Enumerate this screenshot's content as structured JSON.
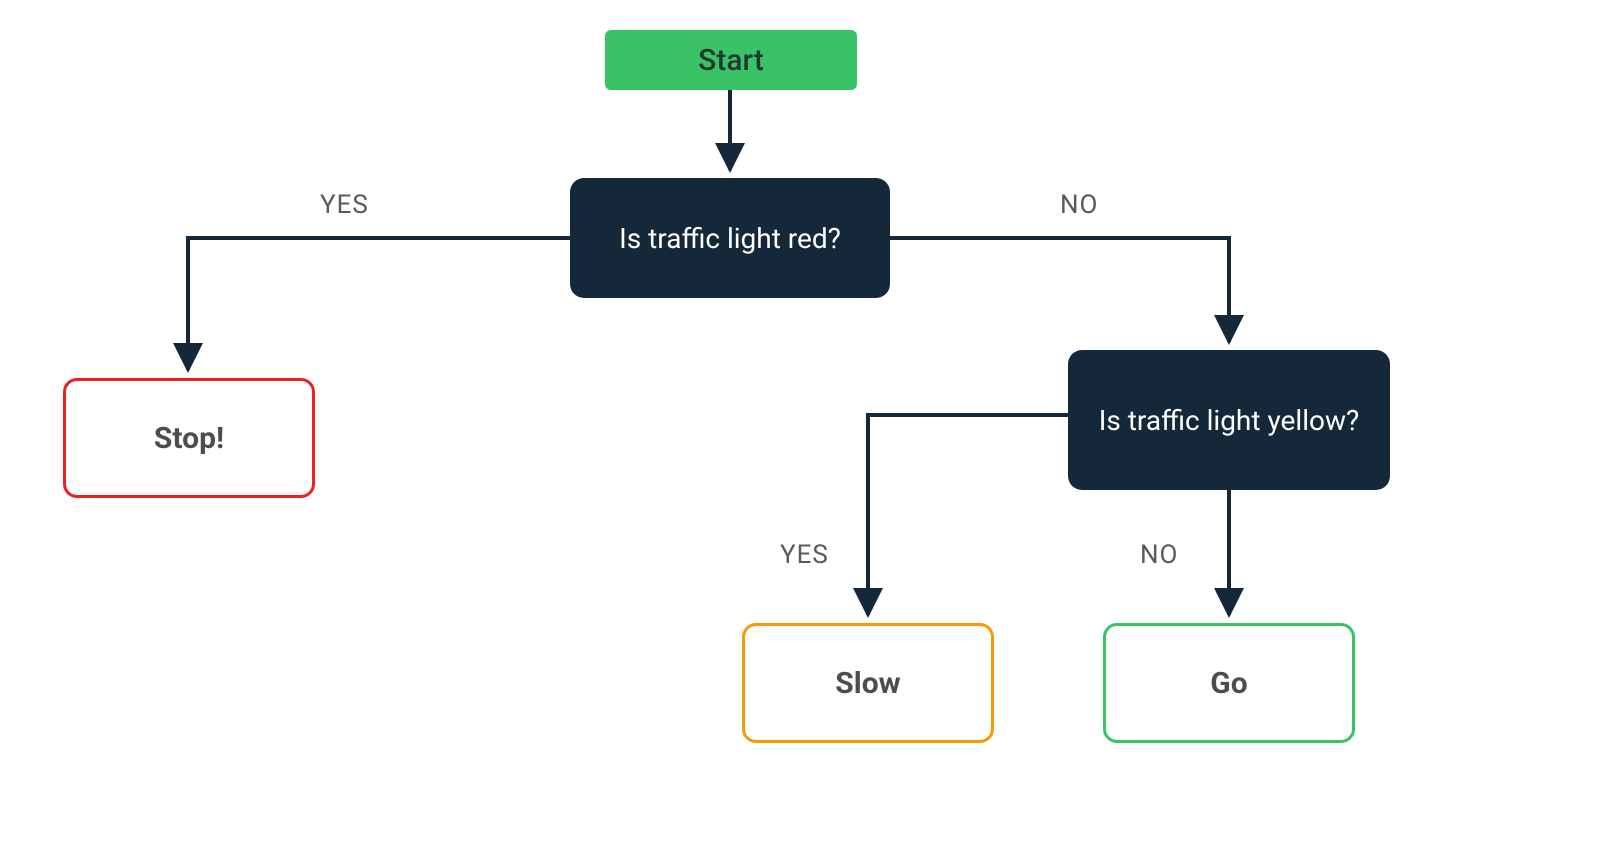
{
  "flowchart": {
    "nodes": {
      "start": {
        "label": "Start"
      },
      "q_red": {
        "label": "Is traffic light red?"
      },
      "q_yellow": {
        "label": "Is traffic light yellow?"
      },
      "stop": {
        "label": "Stop!"
      },
      "slow": {
        "label": "Slow"
      },
      "go": {
        "label": "Go"
      }
    },
    "branch_labels": {
      "red_yes": "YES",
      "red_no": "NO",
      "yellow_yes": "YES",
      "yellow_no": "NO"
    },
    "colors": {
      "start_bg": "#39c366",
      "decision_bg": "#14283a",
      "stop_border": "#ef2020",
      "slow_border": "#f59b0a",
      "go_border": "#39c366",
      "connector": "#14283a"
    }
  }
}
